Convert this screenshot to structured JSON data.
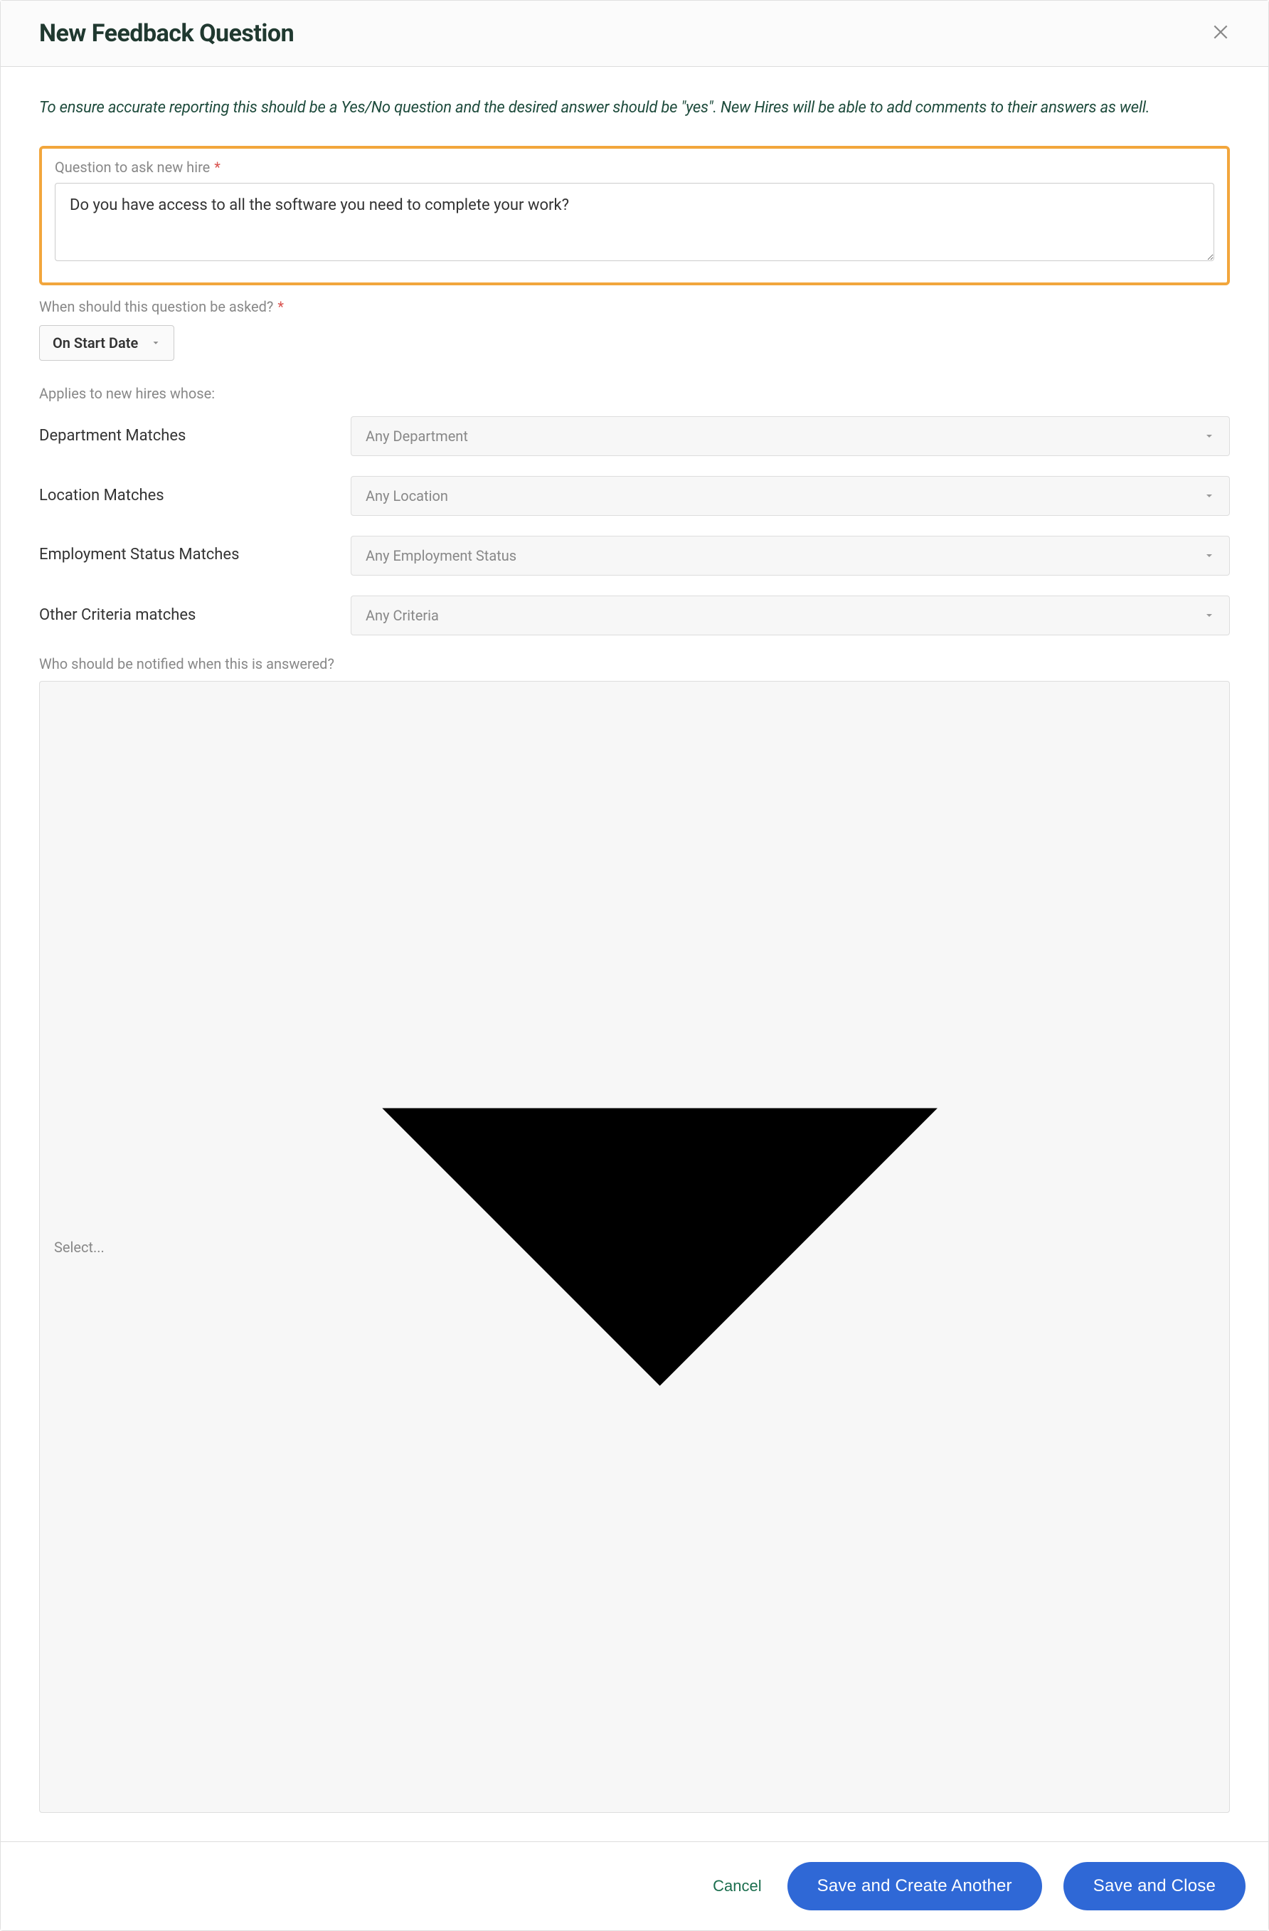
{
  "header": {
    "title": "New Feedback Question"
  },
  "instructions": "To ensure accurate reporting this should be a Yes/No question and the desired answer should be \"yes\". New Hires will be able to add comments to their answers as well.",
  "question_section": {
    "label": "Question to ask new hire",
    "required_mark": "*",
    "value": "Do you have access to all the software you need to complete your work?"
  },
  "when_section": {
    "label": "When should this question be asked?",
    "required_mark": "*",
    "selected": "On Start Date"
  },
  "applies_label": "Applies to new hires whose:",
  "filters": [
    {
      "label": "Department Matches",
      "placeholder": "Any Department"
    },
    {
      "label": "Location Matches",
      "placeholder": "Any Location"
    },
    {
      "label": "Employment Status Matches",
      "placeholder": "Any Employment Status"
    },
    {
      "label": "Other Criteria matches",
      "placeholder": "Any Criteria"
    }
  ],
  "notify": {
    "label": "Who should be notified when this is answered?",
    "placeholder": "Select..."
  },
  "footer": {
    "cancel": "Cancel",
    "save_another": "Save and Create Another",
    "save_close": "Save and Close"
  }
}
